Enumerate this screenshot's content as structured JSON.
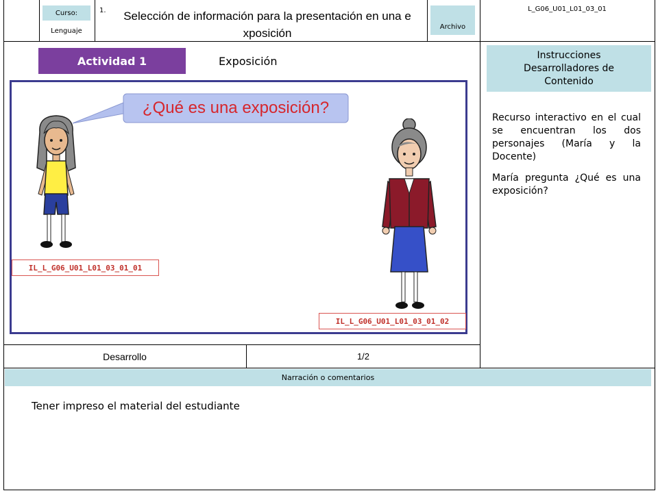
{
  "header": {
    "curso_label": "Curso:",
    "curso_value": "Lenguaje",
    "number": "1.",
    "title": "Selección de información para la presentación en una exposición",
    "archivo_label": "Archivo",
    "code": "L_G06_U01_L01_03_01"
  },
  "activity": {
    "badge": "Actividad 1",
    "subtitle": "Exposición"
  },
  "scene": {
    "speech": "¿Qué es una exposición?",
    "image_id_1": "IL_L_G06_U01_L01_03_01_01",
    "image_id_2": "IL_L_G06_U01_L01_03_01_02"
  },
  "instructions": {
    "title": "Instrucciones Desarrolladores de Contenido",
    "paragraph1": "Recurso interactivo en el cual se encuentran los dos personajes (María y la Docente)",
    "paragraph2": "María pregunta ¿Qué es una exposición?"
  },
  "footer_row": {
    "stage": "Desarrollo",
    "page": "1/2"
  },
  "narration": {
    "label": "Narración o comentarios",
    "text": "Tener impreso el material del estudiante"
  },
  "colors": {
    "badge": "#7b3f9e",
    "tag_bg": "#bfe0e6",
    "frame": "#3b3b8f",
    "red": "#c0302a"
  }
}
